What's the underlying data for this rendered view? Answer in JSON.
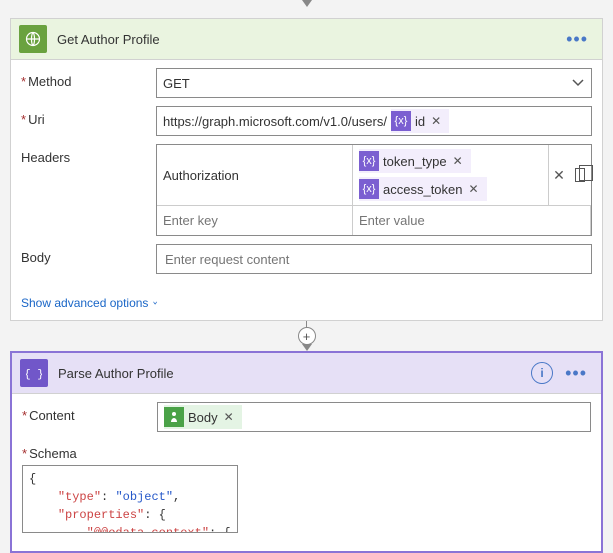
{
  "steps": {
    "getProfile": {
      "title": "Get Author Profile",
      "method_label": "Method",
      "method_value": "GET",
      "uri_label": "Uri",
      "uri_prefix": "https://graph.microsoft.com/v1.0/users/",
      "uri_token": "id",
      "headers_label": "Headers",
      "header_key": "Authorization",
      "header_key_placeholder": "Enter key",
      "header_value_placeholder": "Enter value",
      "header_tokens": [
        "token_type",
        "access_token"
      ],
      "body_label": "Body",
      "body_placeholder": "Enter request content",
      "advanced_link": "Show advanced options"
    },
    "parseProfile": {
      "title": "Parse Author Profile",
      "content_label": "Content",
      "content_token": "Body",
      "schema_label": "Schema",
      "schema_lines": [
        {
          "raw": "{"
        },
        {
          "indent": 1,
          "key": "type",
          "value": "object",
          "trail": ","
        },
        {
          "indent": 1,
          "key": "properties",
          "open": true
        },
        {
          "indent": 2,
          "key": "@@odata.context",
          "open": true
        }
      ]
    }
  }
}
